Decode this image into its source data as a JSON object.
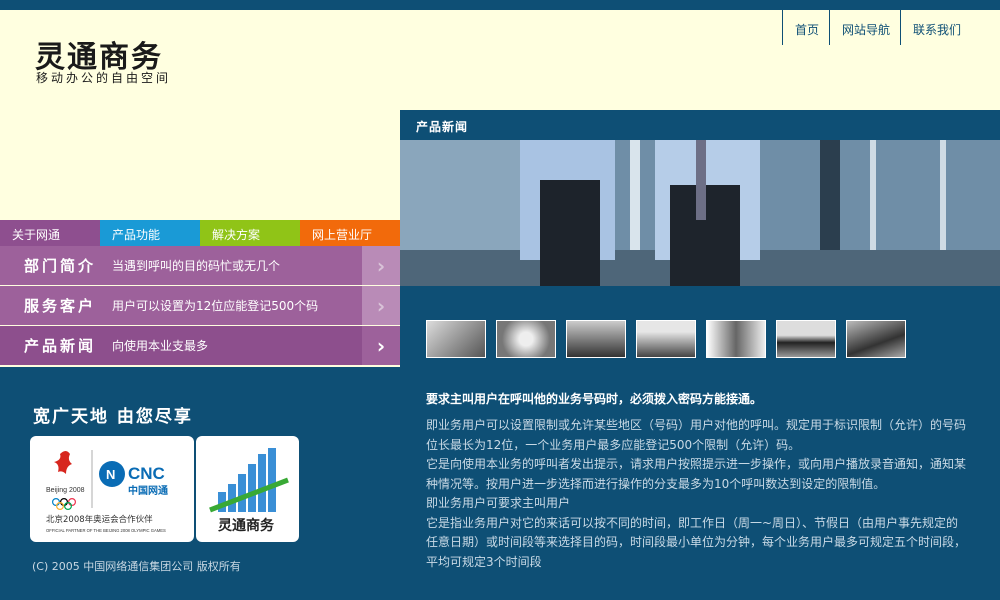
{
  "header": {
    "logo_title": "灵通商务",
    "logo_subtitle": "移动办公的自由空间",
    "nav": [
      "首页",
      "网站导航",
      "联系我们"
    ]
  },
  "tabs": [
    "关于网通",
    "产品功能",
    "解决方案",
    "网上营业厅"
  ],
  "menu": [
    {
      "title": "部门简介",
      "desc": "当遇到呼叫的目的码忙或无几个"
    },
    {
      "title": "服务客户",
      "desc": "用户可以设置为12位应能登记500个码"
    },
    {
      "title": "产品新闻",
      "desc": "向使用本业支最多"
    }
  ],
  "slogan": "宽广天地 由您尽享",
  "cards": {
    "olympic_line1": "Beijing 2008",
    "cnc_logo": "CNC",
    "cnc_name": "中国网通",
    "partner_cn": "北京2008年奥运会合作伙伴",
    "partner_en": "OFFICIAL PARTNER OF THE BEIJING 2008 OLYMPIC GAMES",
    "brand": "灵通商务"
  },
  "copyright": "(C) 2005 中国网络通信集团公司 版权所有",
  "section": {
    "title": "产品新闻",
    "thumb_count": 7,
    "article_title": "要求主叫用户在呼叫他的业务号码时，必须拨入密码方能接通。",
    "paragraphs": [
      "即业务用户可以设置限制或允许某些地区（号码）用户对他的呼叫。规定用于标识限制（允许）的号码位长最长为12位，一个业务用户最多应能登记500个限制（允许）码。",
      "它是向使用本业务的呼叫者发出提示，请求用户按照提示进一步操作，或向用户播放录音通知，通知某种情况等。按用户进一步选择而进行操作的分支最多为10个呼叫数达到设定的限制值。",
      "即业务用户可要求主叫用户",
      "它是指业务用户对它的来话可以按不同的时间，即工作日（周一~周日）、节假日（由用户事先规定的任意日期）或时间段等来选择目的码，时间段最小单位为分钟，每个业务用户最多可规定五个时间段，平均可规定3个时间段"
    ]
  },
  "colors": {
    "navy": "#0e4f75",
    "cream": "#ffffe0",
    "purple": "#9d619b",
    "tab_blue": "#1a9ad6",
    "tab_green": "#90c417",
    "tab_orange": "#f26a0b"
  }
}
